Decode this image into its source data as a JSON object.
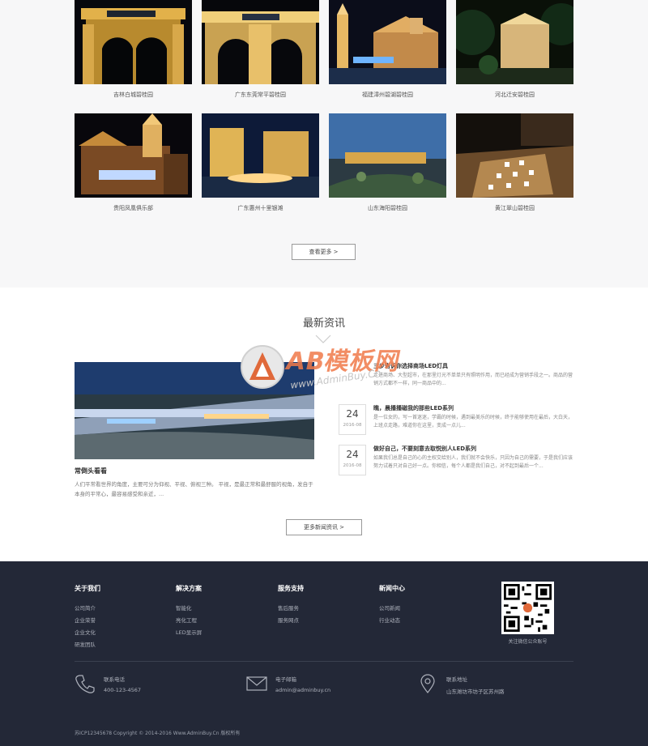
{
  "cases": {
    "items": [
      {
        "caption": "吉林白城碧桂园"
      },
      {
        "caption": "广东东莞常平碧桂园"
      },
      {
        "caption": "福建漳州碧湖碧桂园"
      },
      {
        "caption": "河北迁安碧桂园"
      },
      {
        "caption": "贵阳凤凰俱乐部"
      },
      {
        "caption": "广东惠州十里银滩"
      },
      {
        "caption": "山东海阳碧桂园"
      },
      {
        "caption": "黄江翠山碧桂园"
      }
    ],
    "more_label": "查看更多 >"
  },
  "news": {
    "title": "最新资讯",
    "featured": {
      "title": "常倒头看看",
      "desc": "人们平常看世界的角度，主要可分为仰视、平视、俯视三种。 平视，是最正常和最舒服的视角，发自于本身的平常心，最容易感受和亲近，..."
    },
    "items": [
      {
        "day": "",
        "month": "",
        "title": "三步告诉你选择商场LED灯具",
        "summary": "走进商场、大型超市，在那里灯光不单单只有照明作用，而已经成为营销手段之一。商品的营销方式都不一样，同一商品中的..."
      },
      {
        "day": "24",
        "month": "2016-08",
        "title": "瞧，晨播播磁我的那些LED系列",
        "summary": "是一位女的，写一首迷迷，学霸的时候，遇到最美乐的时候，终于能够使用在最后，大白天，上班点走路，难道你在这里，变成一点儿..."
      },
      {
        "day": "24",
        "month": "2016-08",
        "title": "做好自己，不要刻意去取悦别人LED系列",
        "summary": "如果我们总是自己的心的主权交给别人，我们就不会快乐，只因为自己的需要，于是我们应该努力试着只对自己好一点。你相信，每个人都是我们自己，对不起到最后一个..."
      }
    ],
    "more_label": "更多新闻资讯 >"
  },
  "watermark": {
    "brand": "AB模板网",
    "url": "www.AdminBuy.Cn"
  },
  "footer": {
    "columns": [
      {
        "title": "关于我们",
        "links": [
          "公司简介",
          "企业荣誉",
          "企业文化",
          "研发团队"
        ]
      },
      {
        "title": "解决方案",
        "links": [
          "智能化",
          "亮化工程",
          "LED显示屏"
        ]
      },
      {
        "title": "服务支持",
        "links": [
          "售后服务",
          "服务网点"
        ]
      },
      {
        "title": "新闻中心",
        "links": [
          "公司新闻",
          "行业动态"
        ]
      }
    ],
    "qr_caption": "关注微信公众账号",
    "contacts": [
      {
        "icon": "phone-icon",
        "label": "联系电话",
        "value": "400-123-4567"
      },
      {
        "icon": "mail-icon",
        "label": "电子邮箱",
        "value": "admin@adminbuy.cn"
      },
      {
        "icon": "location-icon",
        "label": "联系地址",
        "value": "山东潍坊市坊子区苏州路"
      }
    ],
    "copyright": "苏ICP12345678    Copyright © 2014-2016 Www.AdminBuy.Cn 版权所有"
  },
  "colors": {
    "footer_bg": "#232837",
    "page_bg": "#f7f7f8",
    "watermark_orange": "#f07a4a"
  }
}
